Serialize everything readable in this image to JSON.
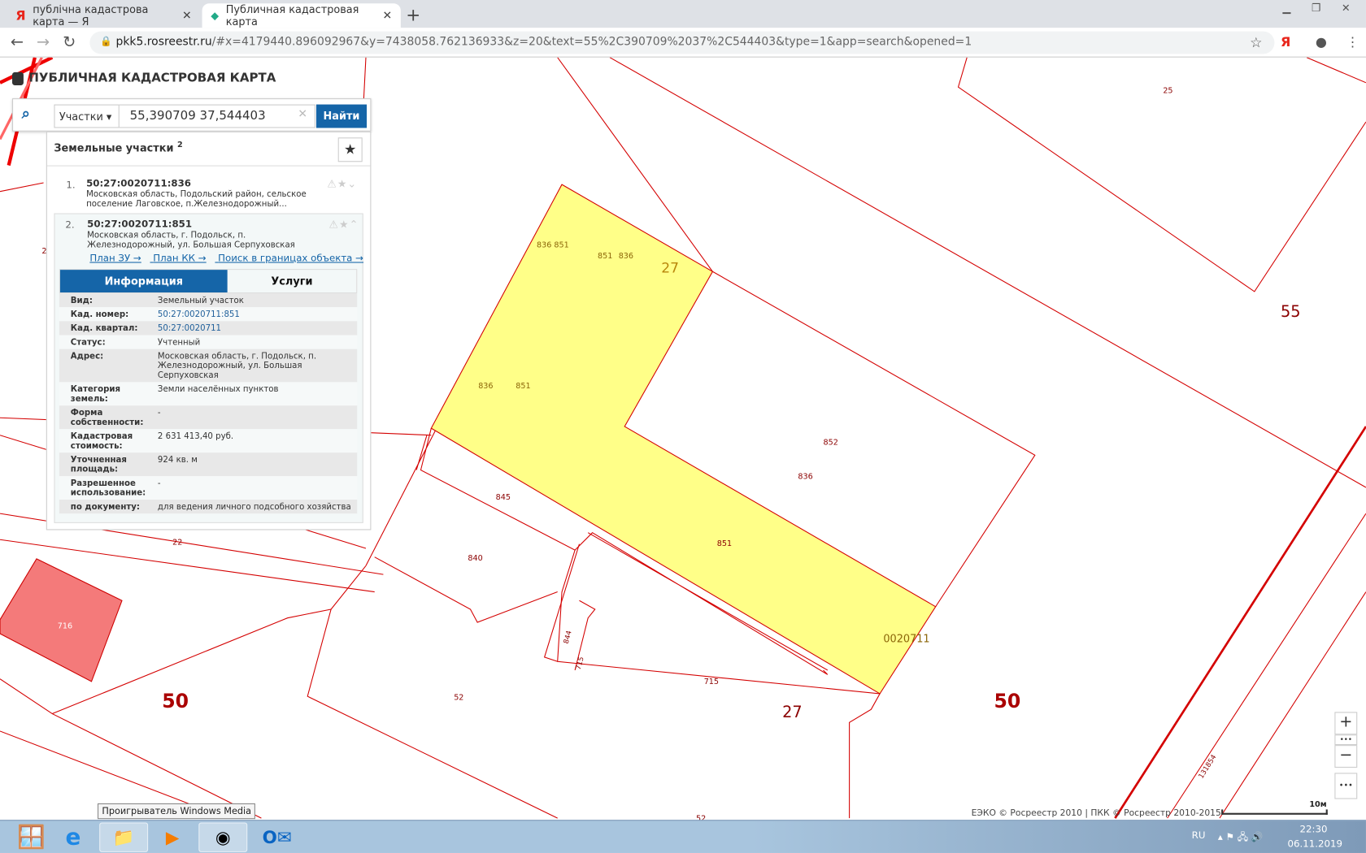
{
  "browser": {
    "tabs": [
      {
        "label": "публічна кадастрова карта — Я"
      },
      {
        "label": "Публичная кадастровая карта"
      }
    ],
    "url_host": "pkk5.rosreestr.ru",
    "url_rest": "/#x=4179440.896092967&y=7438058.762136933&z=20&text=55%2C390709%2037%2C544403&type=1&app=search&opened=1",
    "yandex_icon": "Я"
  },
  "app": {
    "title": "ПУБЛИЧНАЯ КАДАСТРОВАЯ КАРТА"
  },
  "search": {
    "type": "Участки",
    "value": "55,390709 37,544403",
    "button": "Найти"
  },
  "results": {
    "title": "Земельные участки",
    "count": "2",
    "items": [
      {
        "num": "1.",
        "id": "50:27:0020711:836",
        "address": "Московская область, Подольский район, сельское поселение Лаговское, п.Железнодорожный..."
      },
      {
        "num": "2.",
        "id": "50:27:0020711:851",
        "address": "Московская область, г. Подольск, п. Железнодорожный, ул. Большая Серпуховская"
      }
    ],
    "links": [
      "План ЗУ →",
      "План КК →",
      "Поиск в границах объекта →"
    ],
    "tabs": [
      "Информация",
      "Услуги"
    ],
    "info": [
      {
        "k": "Вид:",
        "v": "Земельный участок"
      },
      {
        "k": "Кад. номер:",
        "v": "50:27:0020711:851"
      },
      {
        "k": "Кад. квартал:",
        "v": "50:27:0020711"
      },
      {
        "k": "Статус:",
        "v": "Учтенный"
      },
      {
        "k": "Адрес:",
        "v": "Московская область, г. Подольск, п. Железнодорожный, ул. Большая Серпуховская"
      },
      {
        "k": "Категория земель:",
        "v": "Земли населённых пунктов"
      },
      {
        "k": "Форма собственности:",
        "v": "-"
      },
      {
        "k": "Кадастровая стоимость:",
        "v": "2 631 413,40 руб."
      },
      {
        "k": "Уточненная площадь:",
        "v": "924 кв. м"
      },
      {
        "k": "Разрешенное использование:",
        "v": "-"
      },
      {
        "k": "по документу:",
        "v": "для ведения личного подсобного хозяйства"
      }
    ]
  },
  "map": {
    "labels": {
      "q27a": "27",
      "q55": "55",
      "q50a": "50",
      "q50b": "50",
      "q27b": "27",
      "p852": "852",
      "p836": "836",
      "p851": "851",
      "kv": "0020711",
      "p845": "845",
      "p840": "840",
      "p52a": "52",
      "p715": "715",
      "p844": "844",
      "p715b": "715",
      "p22": "22",
      "p25": "25",
      "p52b": "52",
      "p131854": "131854",
      "p716": "716",
      "y836a": "836",
      "y851a": "851",
      "y851b": "851",
      "y836b": "836",
      "y836c": "836",
      "y851c": "851",
      "p2": "2"
    },
    "colors": {
      "selected": "#ffff88",
      "highlight": "#f47a7a",
      "boundary": "#d40000"
    },
    "copyright": "ЕЭКО © Росреестр 2010 | ПКК © Росреестр 2010-2015",
    "scale": "10м"
  },
  "taskbar": {
    "tooltip": "Проигрыватель Windows Media",
    "lang": "RU",
    "time": "22:30",
    "date": "06.11.2019"
  }
}
